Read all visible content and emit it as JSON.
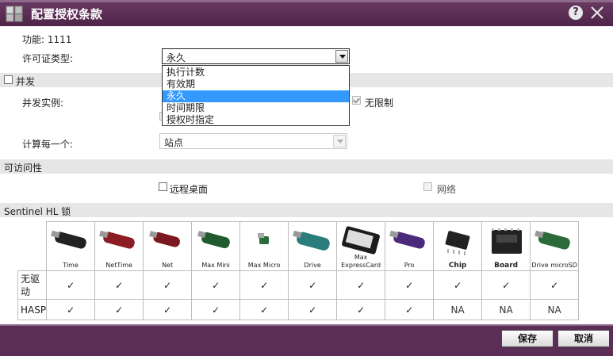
{
  "dialog": {
    "title": "配置授权条款"
  },
  "feature": {
    "text": "功能: 1111"
  },
  "license_type": {
    "label": "许可证类型:",
    "selected": "永久",
    "options": [
      "执行计数",
      "有效期",
      "永久",
      "时间期限",
      "授权时指定"
    ]
  },
  "concurrency": {
    "section": "并发",
    "instances_label": "并发实例:",
    "unlimited_label": "无限制",
    "count_per_label": "计算每一个:",
    "count_per_value": "站点"
  },
  "accessibility": {
    "section": "可访问性",
    "remote_desktop": "远程桌面",
    "network": "网络"
  },
  "hl": {
    "section": "Sentinel HL 锁",
    "products": [
      "Time",
      "NetTime",
      "Net",
      "Max Mini",
      "Max Micro",
      "Drive",
      "Max ExpressCard",
      "Pro",
      "Chip",
      "Board",
      "Drive microSD"
    ],
    "rows": [
      {
        "label": "无驱动",
        "values": [
          "✓",
          "✓",
          "✓",
          "✓",
          "✓",
          "✓",
          "✓",
          "✓",
          "✓",
          "✓",
          "✓"
        ]
      },
      {
        "label": "HASP",
        "values": [
          "✓",
          "✓",
          "✓",
          "✓",
          "✓",
          "✓",
          "✓",
          "✓",
          "NA",
          "NA",
          "NA"
        ]
      }
    ]
  },
  "buttons": {
    "save": "保存",
    "cancel": "取消"
  },
  "colors": {
    "title_bar": "#4f2449",
    "selection": "#3399ff"
  }
}
